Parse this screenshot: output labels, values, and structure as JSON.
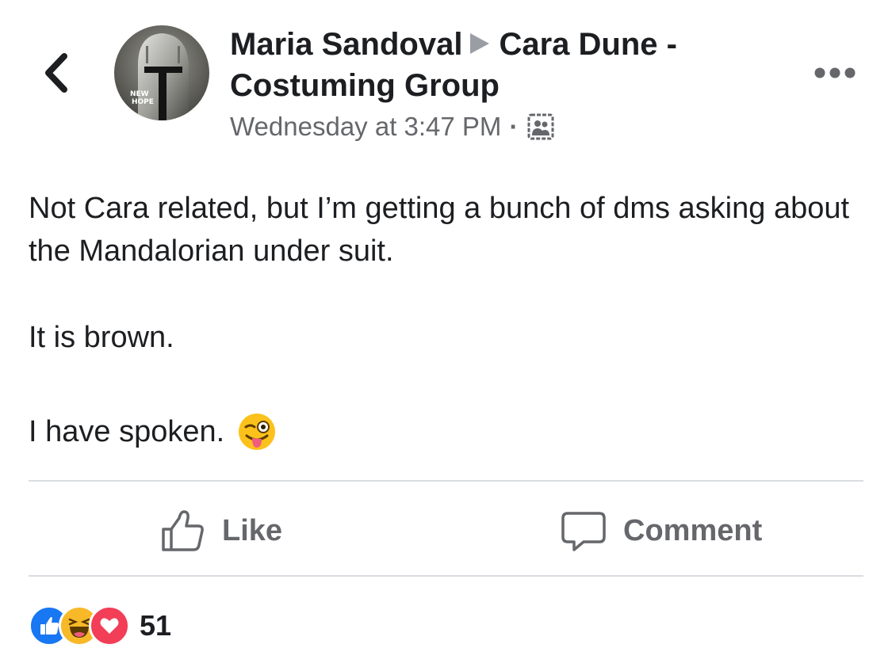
{
  "header": {
    "author": "Maria Sandoval",
    "group": "Cara Dune - Costuming Group",
    "timestamp": "Wednesday at 3:47 PM",
    "separator": "·",
    "audience_icon": "group-members-icon",
    "back_icon": "chevron-left-icon",
    "more_icon": "more-options-icon",
    "avatar_text": [
      "NEW",
      "HOPE"
    ]
  },
  "post": {
    "paragraph1": "Not Cara related, but I’m getting a bunch of dms asking about the Mandalorian under suit.",
    "paragraph2": "It is brown.",
    "paragraph3": "I have spoken.",
    "emoji": "winking-face-with-tongue"
  },
  "actions": {
    "like_label": "Like",
    "comment_label": "Comment"
  },
  "reactions": {
    "types": [
      "like",
      "haha",
      "love"
    ],
    "count": "51"
  },
  "colors": {
    "text": "#1c1e21",
    "secondary": "#65676b",
    "like_blue": "#1877f2",
    "love_red": "#f33e58",
    "haha_yellow": "#f7b928",
    "divider": "#dadde1"
  }
}
